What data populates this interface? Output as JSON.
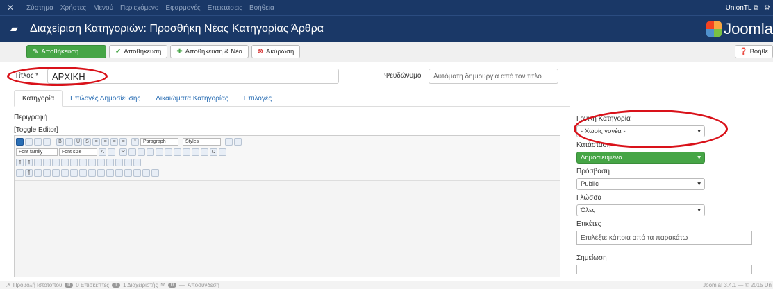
{
  "topnav": {
    "items": [
      "Σύστημα",
      "Χρήστες",
      "Μενού",
      "Περιεχόμενο",
      "Εφαρμογές",
      "Επεκτάσεις",
      "Βοήθεια"
    ],
    "user_label": "UnionTL"
  },
  "header": {
    "title": "Διαχείριση Κατηγοριών: Προσθήκη Νέας Κατηγορίας Άρθρα",
    "brand": "Joomla"
  },
  "toolbar": {
    "save_label": "Αποθήκευση",
    "save_close_label": "Αποθήκευση",
    "save_new_label": "Αποθήκευση & Νέο",
    "cancel_label": "Ακύρωση",
    "help_label": "Βοήθε"
  },
  "form": {
    "title_label": "Τίτλος *",
    "title_value": "ΑΡΧΙΚΗ",
    "alias_label": "Ψευδώνυμο",
    "alias_placeholder": "Αυτόματη δημιουργία από τον τίτλο"
  },
  "tabs": [
    "Κατηγορία",
    "Επιλογές Δημοσίευσης",
    "Δικαιώματα Κατηγορίας",
    "Επιλογές"
  ],
  "editor": {
    "description_label": "Περιγραφή",
    "toggle_label": "[Toggle Editor]",
    "paragraph": "Paragraph",
    "styles": "Styles",
    "font_family": "Font family",
    "font_size": "Font size"
  },
  "sidebar": {
    "parent_label": "Γονική Κατηγορία",
    "parent_value": "- Χωρίς γονέα -",
    "status_label": "Κατάσταση",
    "status_value": "Δημοσιευμένο",
    "access_label": "Πρόσβαση",
    "access_value": "Public",
    "language_label": "Γλώσσα",
    "language_value": "Όλες",
    "tags_label": "Ετικέτες",
    "tags_placeholder": "Επιλέξτε κάποια από τα παρακάτω",
    "note_label": "Σημείωση"
  },
  "footer": {
    "view_site": "Προβολή Ιστοτόπου",
    "visitors_count": "0",
    "visitors_label": "0 Επισκέπτες",
    "admins_count": "1",
    "admins_label": "1 Διαχειριστής",
    "messages_count": "0",
    "logout": "Αποσύνδεση",
    "version": "Joomla! 3.4.1 — © 2015 Un"
  },
  "colors": {
    "nav_bg": "#1a3867",
    "green": "#46a546",
    "red_annotation": "#d9121a",
    "link": "#2a6eb4"
  }
}
